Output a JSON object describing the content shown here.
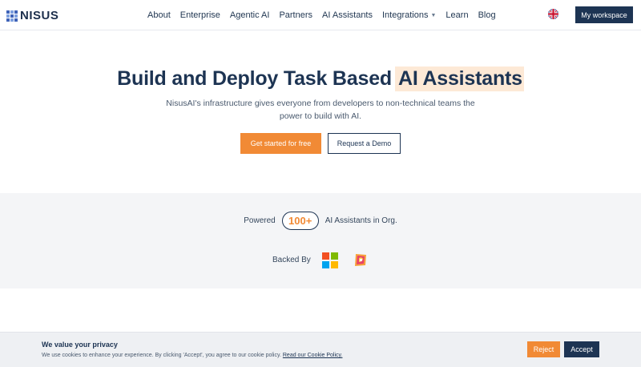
{
  "brand": {
    "name": "NISUS"
  },
  "nav": {
    "items": [
      {
        "label": "About"
      },
      {
        "label": "Enterprise"
      },
      {
        "label": "Agentic AI"
      },
      {
        "label": "Partners"
      },
      {
        "label": "AI Assistants"
      },
      {
        "label": "Integrations"
      },
      {
        "label": "Learn"
      },
      {
        "label": "Blog"
      }
    ],
    "language_icon": "uk-flag-icon",
    "workspace_label": "My workspace"
  },
  "hero": {
    "title_main": "Build and Deploy Task Based",
    "title_highlight": "AI Assistants",
    "subtitle": "NisusAI's infrastructure gives everyone from developers to non-technical teams the power to build with AI.",
    "cta_primary": "Get started for free",
    "cta_secondary": "Request a Demo"
  },
  "stats": {
    "prefix": "Powered",
    "count": "100+",
    "suffix": "AI Assistants in Org.",
    "backed_by": "Backed By",
    "backers": [
      "microsoft-logo",
      "partner-logo"
    ]
  },
  "cookie": {
    "title": "We value your privacy",
    "text": "We use cookies to enhance your experience. By clicking 'Accept', you agree to our cookie policy.",
    "link": "Read our Cookie Policy.",
    "reject_label": "Reject",
    "accept_label": "Accept"
  },
  "colors": {
    "primary": "#1d3453",
    "accent": "#f18a35",
    "highlight": "#fde9d6",
    "band": "#f4f5f7"
  }
}
